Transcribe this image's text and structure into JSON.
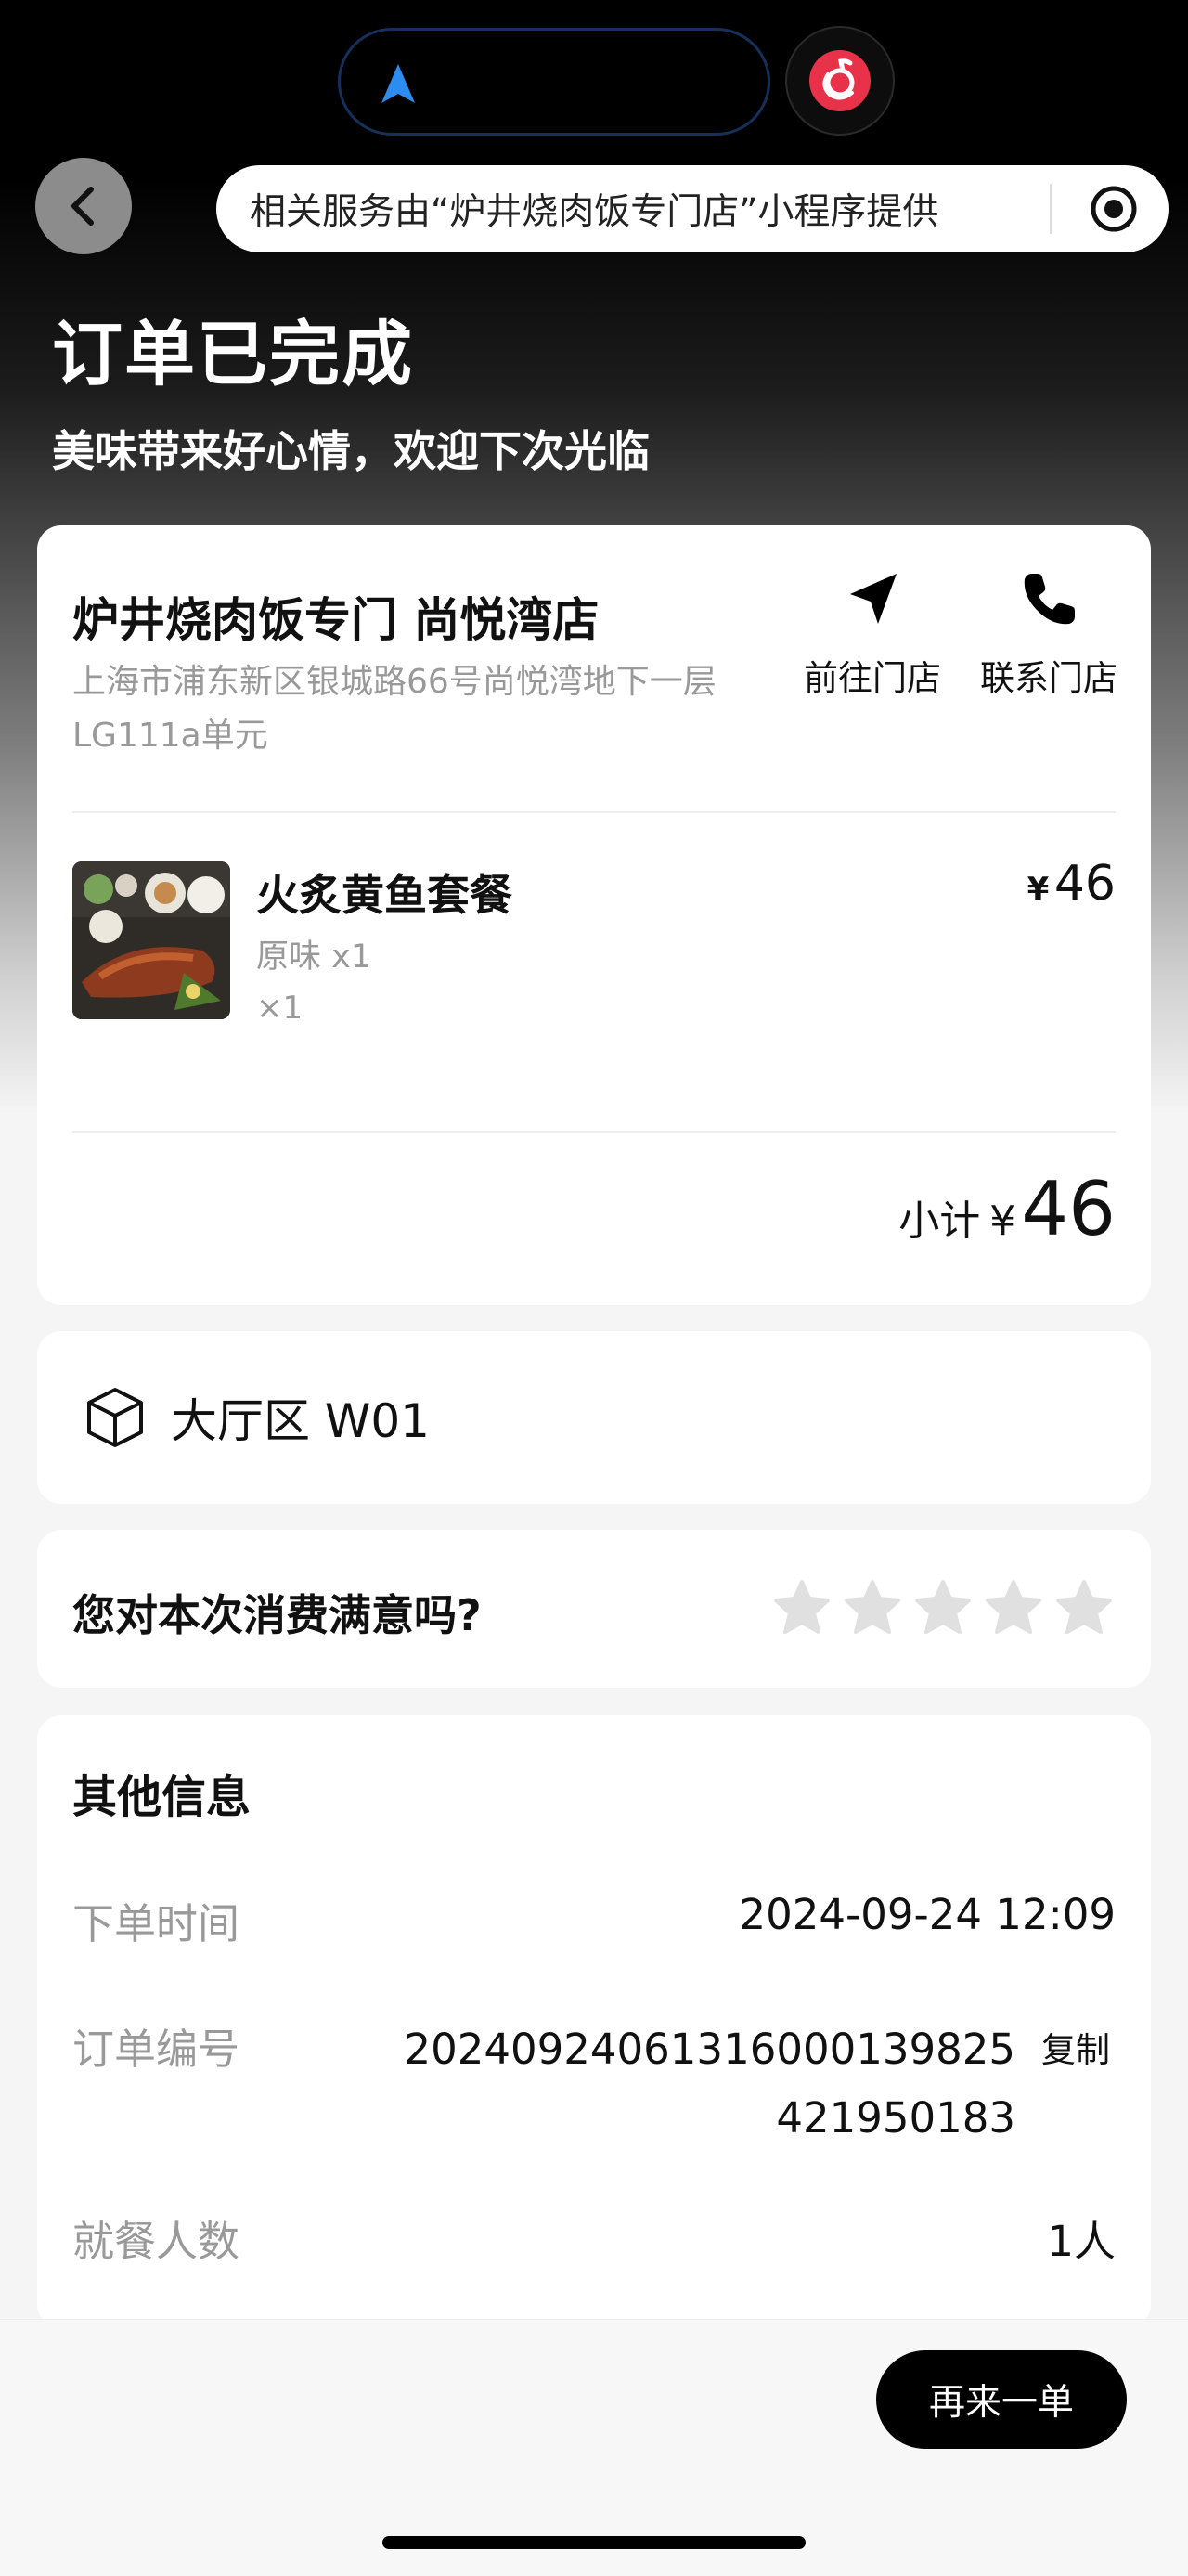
{
  "header": {
    "capsule_text": "相关服务由“炉井烧肉饭专门店”小程序提供",
    "icons": [
      "nav-arrow-icon",
      "netease-music-icon",
      "back-icon",
      "target-icon"
    ]
  },
  "status": {
    "title": "订单已完成",
    "subtitle": "美味带来好心情，欢迎下次光临"
  },
  "store": {
    "name": "炉井烧肉饭专门 尚悦湾店",
    "address": "上海市浦东新区银城路66号尚悦湾地下一层LG111a单元",
    "navigate_label": "前往门店",
    "call_label": "联系门店"
  },
  "item": {
    "name": "火炙黄鱼套餐",
    "spec": "原味 x1",
    "qty": "×1",
    "currency": "¥",
    "price": "46"
  },
  "subtotal": {
    "label": "小计",
    "currency": "¥",
    "amount": "46"
  },
  "table": {
    "label": "大厅区 W01"
  },
  "rating": {
    "question": "您对本次消费满意吗?",
    "stars_total": 5,
    "stars_selected": 0
  },
  "other_info": {
    "title": "其他信息",
    "order_time_label": "下单时间",
    "order_time": "2024-09-24 12:09",
    "order_no_label": "订单编号",
    "order_no": "20240924061316000139825421950183",
    "copy_label": "复制",
    "diners_label": "就餐人数",
    "diners": "1人"
  },
  "footer": {
    "reorder_label": "再来一单"
  },
  "colors": {
    "music_red": "#e8324a",
    "nav_blue": "#2d8cf0",
    "star_gray": "#e0e0e0"
  }
}
